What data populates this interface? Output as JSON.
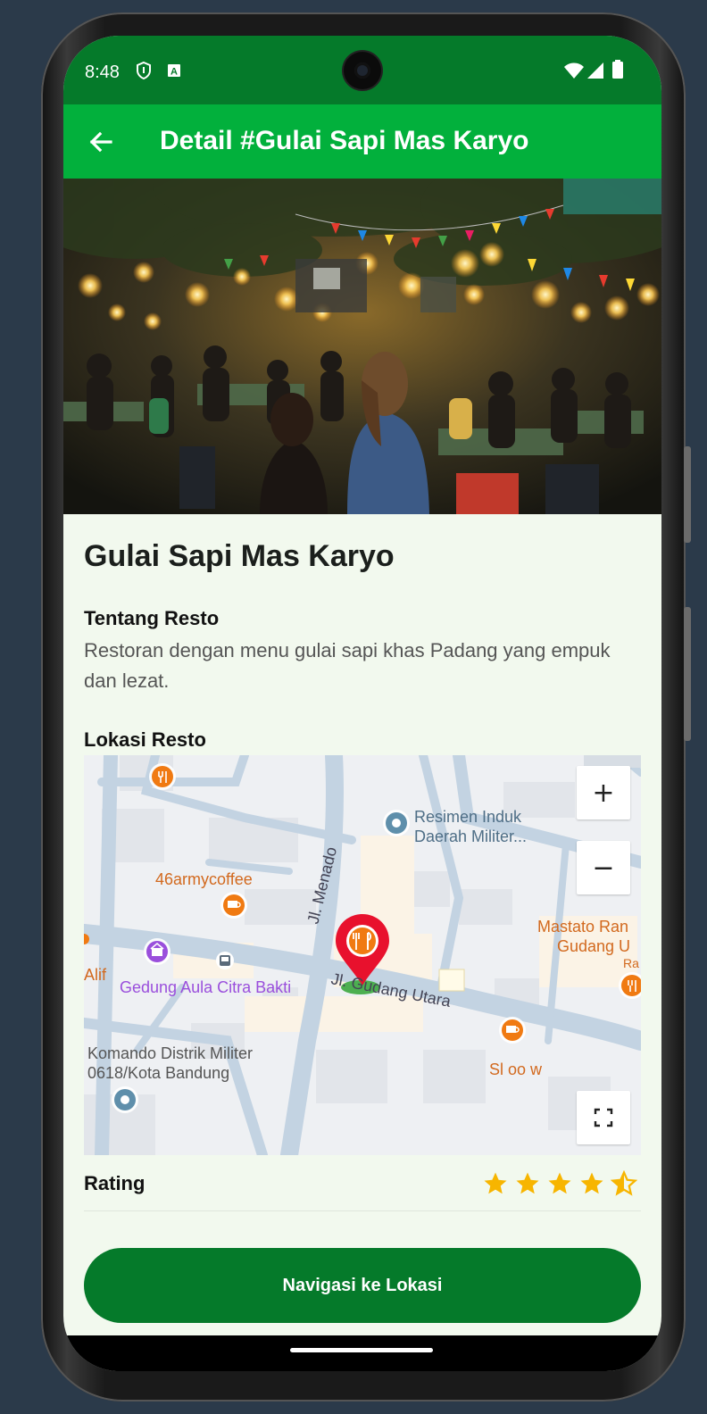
{
  "status_bar": {
    "time": "8:48",
    "left_icons": [
      "shield-icon",
      "a-notification-icon"
    ],
    "right_icons": [
      "wifi-icon",
      "signal-icon",
      "battery-icon"
    ]
  },
  "app_bar": {
    "title": "Detail #Gulai Sapi Mas Karyo",
    "back_icon": "arrow-left-icon"
  },
  "restaurant": {
    "name": "Gulai Sapi Mas Karyo",
    "about_title": "Tentang Resto",
    "about_text": "Restoran dengan menu gulai sapi khas Padang yang empuk dan lezat.",
    "location_title": "Lokasi Resto",
    "rating_label": "Rating",
    "rating_value": 4.5,
    "rating_max": 5
  },
  "map": {
    "zoom_in": "+",
    "zoom_out": "−",
    "labels": {
      "poi_resimen_1": "Resimen Induk",
      "poi_resimen_2": "Daerah Militer...",
      "poi_coffee": "46armycoffee",
      "street_menado": "Jl. Menado",
      "poi_mastato_1": "Mastato Ran",
      "poi_mastato_2": "Gudang U",
      "poi_mastato_3": "Ra",
      "poi_alif": "Alif",
      "poi_gedung": "Gedung Aula Citra Bakti",
      "street_gudang": "Jl. Gudang Utara",
      "poi_komando_1": "Komando Distrik Militer",
      "poi_komando_2": "0618/Kota Bandung",
      "poi_sloow": "Sl oo w"
    },
    "colors": {
      "marker": "#e8112d",
      "food_poi": "#f07a12",
      "purple_poi": "#9a4fdc",
      "blue_poi": "#5f8fab"
    }
  },
  "actions": {
    "navigate_label": "Navigasi ke Lokasi"
  },
  "colors": {
    "status_bar": "#057a2a",
    "app_bar": "#02b03c",
    "button": "#057a2a",
    "star": "#f7b500",
    "background": "#f2f9ee"
  }
}
